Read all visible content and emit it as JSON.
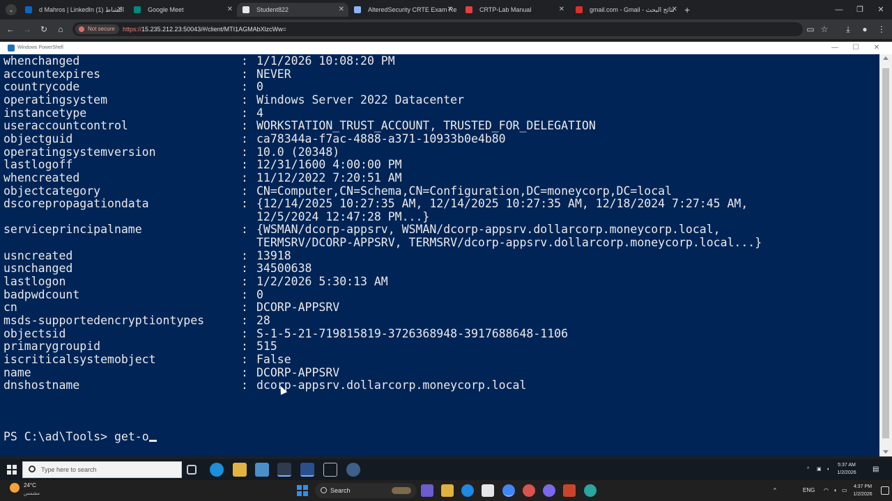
{
  "browser": {
    "tabs": [
      {
        "title": "d Mahros | LinkedIn (1) النشاط",
        "favicon_color": "#0a66c2",
        "active": false
      },
      {
        "title": "Google Meet",
        "favicon_color": "#00897b",
        "active": false
      },
      {
        "title": "Student822",
        "favicon_color": "#e8e8e8",
        "active": true
      },
      {
        "title": "AlteredSecurity CRTE Exam Rep",
        "favicon_color": "#8ab4f8",
        "active": false
      },
      {
        "title": "CRTP-Lab Manual",
        "favicon_color": "#e04040",
        "active": false
      },
      {
        "title": "gmail.com - Gmail - نتائج البحث",
        "favicon_color": "#d93025",
        "active": false
      }
    ],
    "tab_close": "✕",
    "new_tab": "+",
    "security_label": "Not secure",
    "url_protocol": "https://",
    "url_rest": "15.235.212.23:50043/#/client/MTI1AGMAbXlzcWw="
  },
  "remote_window": {
    "title": "Windows PowerShell"
  },
  "console": {
    "rows": [
      {
        "key": "whenchanged",
        "value": "1/1/2026 10:08:20 PM"
      },
      {
        "key": "accountexpires",
        "value": "NEVER"
      },
      {
        "key": "countrycode",
        "value": "0"
      },
      {
        "key": "operatingsystem",
        "value": "Windows Server 2022 Datacenter"
      },
      {
        "key": "instancetype",
        "value": "4"
      },
      {
        "key": "useraccountcontrol",
        "value": "WORKSTATION_TRUST_ACCOUNT, TRUSTED_FOR_DELEGATION"
      },
      {
        "key": "objectguid",
        "value": "ca78344a-f7ac-4888-a371-10933b0e4b80"
      },
      {
        "key": "operatingsystemversion",
        "value": "10.0 (20348)"
      },
      {
        "key": "lastlogoff",
        "value": "12/31/1600 4:00:00 PM"
      },
      {
        "key": "whencreated",
        "value": "11/12/2022 7:20:51 AM"
      },
      {
        "key": "objectcategory",
        "value": "CN=Computer,CN=Schema,CN=Configuration,DC=moneycorp,DC=local"
      },
      {
        "key": "dscorepropagationdata",
        "value": "{12/14/2025 10:27:35 AM, 12/14/2025 10:27:35 AM, 12/18/2024 7:27:45 AM,"
      },
      {
        "key": "",
        "value": "12/5/2024 12:47:28 PM...}"
      },
      {
        "key": "serviceprincipalname",
        "value": "{WSMAN/dcorp-appsrv, WSMAN/dcorp-appsrv.dollarcorp.moneycorp.local,"
      },
      {
        "key": "",
        "value": "TERMSRV/DCORP-APPSRV, TERMSRV/dcorp-appsrv.dollarcorp.moneycorp.local...}"
      },
      {
        "key": "usncreated",
        "value": "13918"
      },
      {
        "key": "usnchanged",
        "value": "34500638"
      },
      {
        "key": "lastlogon",
        "value": "1/2/2026 5:30:13 AM"
      },
      {
        "key": "badpwdcount",
        "value": "0"
      },
      {
        "key": "cn",
        "value": "DCORP-APPSRV"
      },
      {
        "key": "msds-supportedencryptiontypes",
        "value": "28"
      },
      {
        "key": "objectsid",
        "value": "S-1-5-21-719815819-3726368948-3917688648-1106"
      },
      {
        "key": "primarygroupid",
        "value": "515"
      },
      {
        "key": "iscriticalsystemobject",
        "value": "False"
      },
      {
        "key": "name",
        "value": "DCORP-APPSRV"
      },
      {
        "key": "dnshostname",
        "value": "dcorp-appsrv.dollarcorp.moneycorp.local"
      }
    ],
    "prompt": "PS C:\\ad\\Tools> ",
    "typed": "get-o"
  },
  "remote_taskbar": {
    "search_placeholder": "Type here to search",
    "tray_lang": "ENG",
    "clock_time": "5:37 AM",
    "clock_date": "1/2/2026"
  },
  "local_taskbar": {
    "weather_temp": "24°C",
    "weather_cond": "مشمس",
    "search_label": "Search",
    "tray_lang": "ENG",
    "clock_time": "4:37 PM",
    "clock_date": "1/2/2026"
  }
}
